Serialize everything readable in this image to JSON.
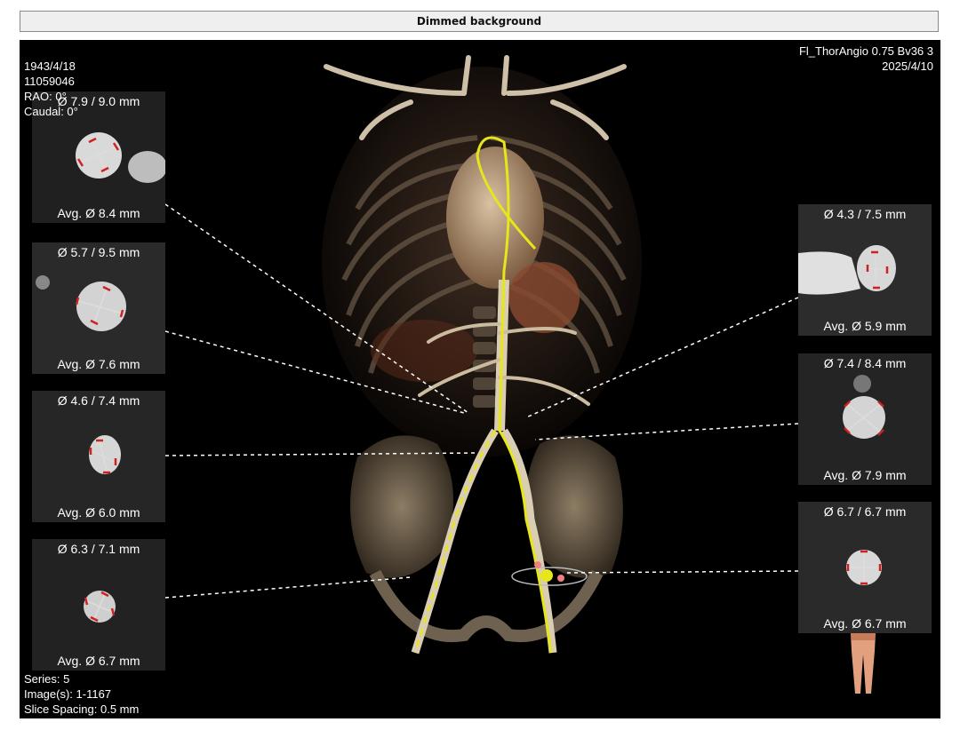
{
  "window": {
    "title": "Dimmed background"
  },
  "overlay": {
    "top_left": [
      "1943/4/18",
      "11059046",
      "RAO: 0°",
      "Caudal: 0°"
    ],
    "top_right": [
      "Fl_ThorAngio  0.75  Bv36  3",
      "2025/4/10"
    ],
    "bottom_left": [
      "Series: 5",
      "Image(s): 1-1167",
      "Slice Spacing: 0.5 mm"
    ]
  },
  "panels": {
    "left": [
      {
        "diameters": "Ø 7.9 / 9.0 mm",
        "average": "Avg. Ø 8.4 mm"
      },
      {
        "diameters": "Ø 5.7 / 9.5 mm",
        "average": "Avg. Ø 7.6 mm"
      },
      {
        "diameters": "Ø 4.6 / 7.4 mm",
        "average": "Avg. Ø 6.0 mm"
      },
      {
        "diameters": "Ø 6.3 / 7.1 mm",
        "average": "Avg. Ø 6.7 mm"
      }
    ],
    "right": [
      {
        "diameters": "Ø 4.3 / 7.5 mm",
        "average": "Avg. Ø 5.9 mm"
      },
      {
        "diameters": "Ø 7.4 / 8.4 mm",
        "average": "Avg. Ø 7.9 mm"
      },
      {
        "diameters": "Ø 6.7 / 6.7 mm",
        "average": "Avg. Ø 6.7 mm"
      }
    ]
  },
  "colors": {
    "viewer_bg": "#000000",
    "centerline": "#e6e61a",
    "measure_marker": "#cc2222",
    "overlay_text": "#ffffff"
  },
  "icons": {
    "orientation": "body-orientation-icon"
  }
}
